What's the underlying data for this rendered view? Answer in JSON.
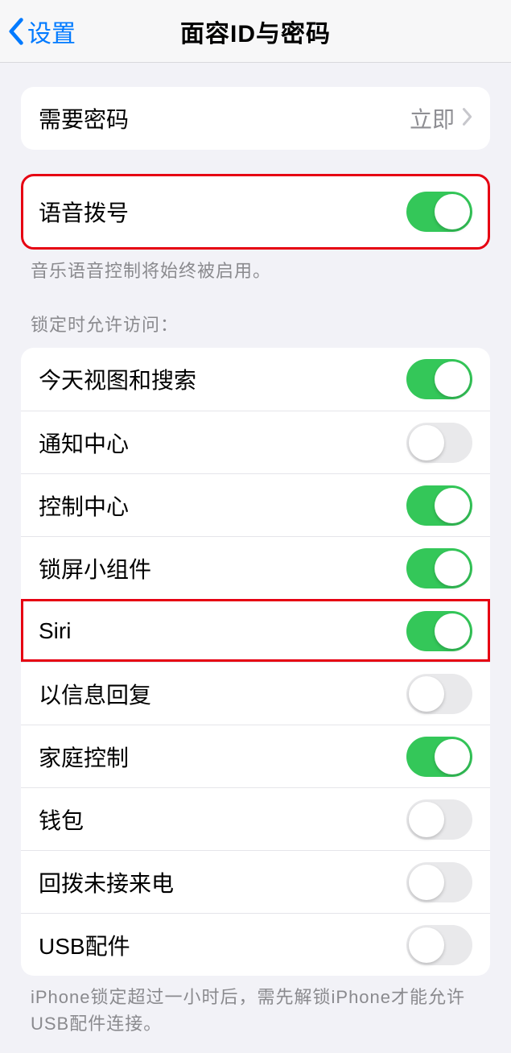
{
  "nav": {
    "back_label": "设置",
    "title": "面容ID与密码"
  },
  "require_passcode": {
    "label": "需要密码",
    "value": "立即"
  },
  "voice_dial": {
    "label": "语音拨号",
    "on": true,
    "footnote": "音乐语音控制将始终被启用。"
  },
  "lock_section_header": "锁定时允许访问：",
  "lock_items": [
    {
      "label": "今天视图和搜索",
      "on": true
    },
    {
      "label": "通知中心",
      "on": false
    },
    {
      "label": "控制中心",
      "on": true
    },
    {
      "label": "锁屏小组件",
      "on": true
    },
    {
      "label": "Siri",
      "on": true
    },
    {
      "label": "以信息回复",
      "on": false
    },
    {
      "label": "家庭控制",
      "on": true
    },
    {
      "label": "钱包",
      "on": false
    },
    {
      "label": "回拨未接来电",
      "on": false
    },
    {
      "label": "USB配件",
      "on": false
    }
  ],
  "usb_footnote": "iPhone锁定超过一小时后，需先解锁iPhone才能允许USB配件连接。"
}
